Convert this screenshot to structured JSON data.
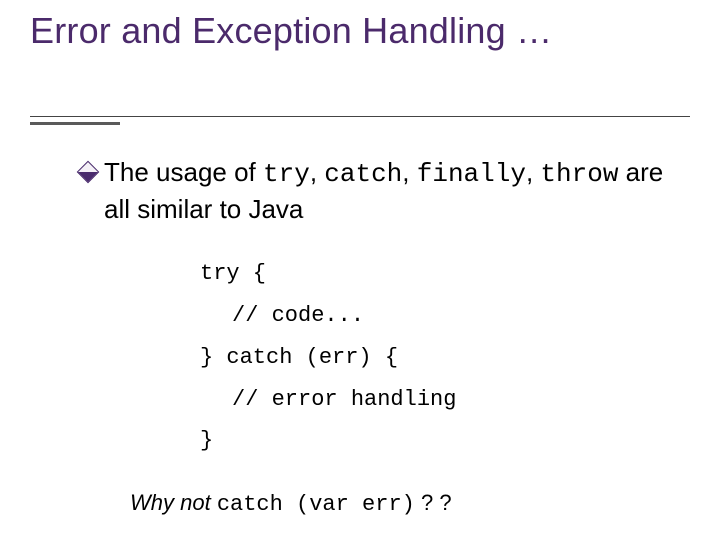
{
  "title": "Error and Exception Handling …",
  "bullet": {
    "pre": "The usage of ",
    "k1": "try",
    "s1": ", ",
    "k2": "catch",
    "s2": ", ",
    "k3": "finally",
    "s3": ", ",
    "k4": "throw",
    "post": " are all similar to Java"
  },
  "code": {
    "l1": "try {",
    "l2": "// code...",
    "l3": "} catch (err) {",
    "l4": "// error handling",
    "l5": "}"
  },
  "footnote": {
    "lead": "Why not ",
    "code": "catch (var err)",
    "tail": " ? ?"
  }
}
